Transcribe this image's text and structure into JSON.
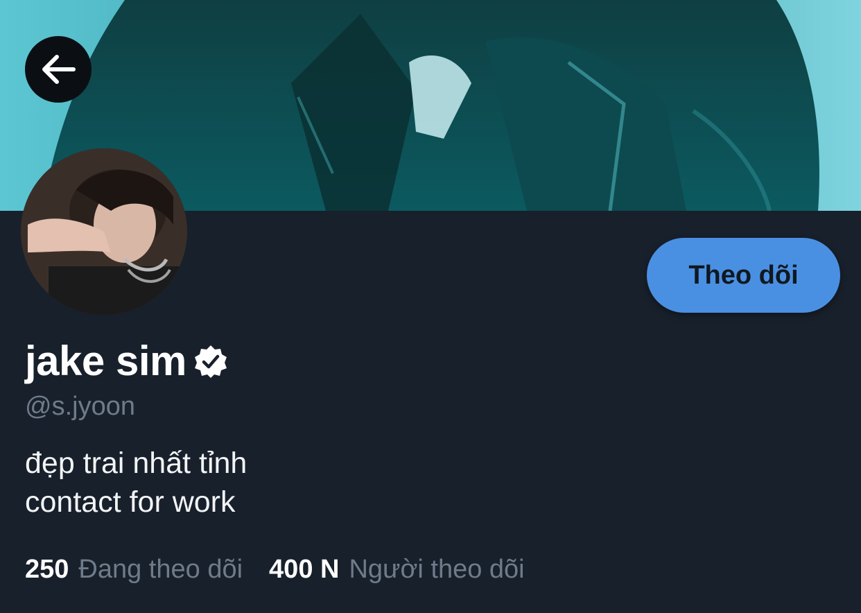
{
  "header": {
    "back_icon": "arrow-left-icon"
  },
  "profile": {
    "display_name": "jake sim",
    "verified_icon": "verified-badge-icon",
    "handle": "@s.jyoon",
    "bio_lines": [
      "đẹp trai nhất tỉnh",
      "contact for work"
    ],
    "follow_label": "Theo dõi"
  },
  "stats": {
    "following_count": "250",
    "following_label": "Đang theo dõi",
    "followers_count": "400 N",
    "followers_label": "Người theo dõi"
  },
  "colors": {
    "accent": "#4a90e2",
    "background": "#18202b",
    "muted_text": "#6f7b8a"
  }
}
